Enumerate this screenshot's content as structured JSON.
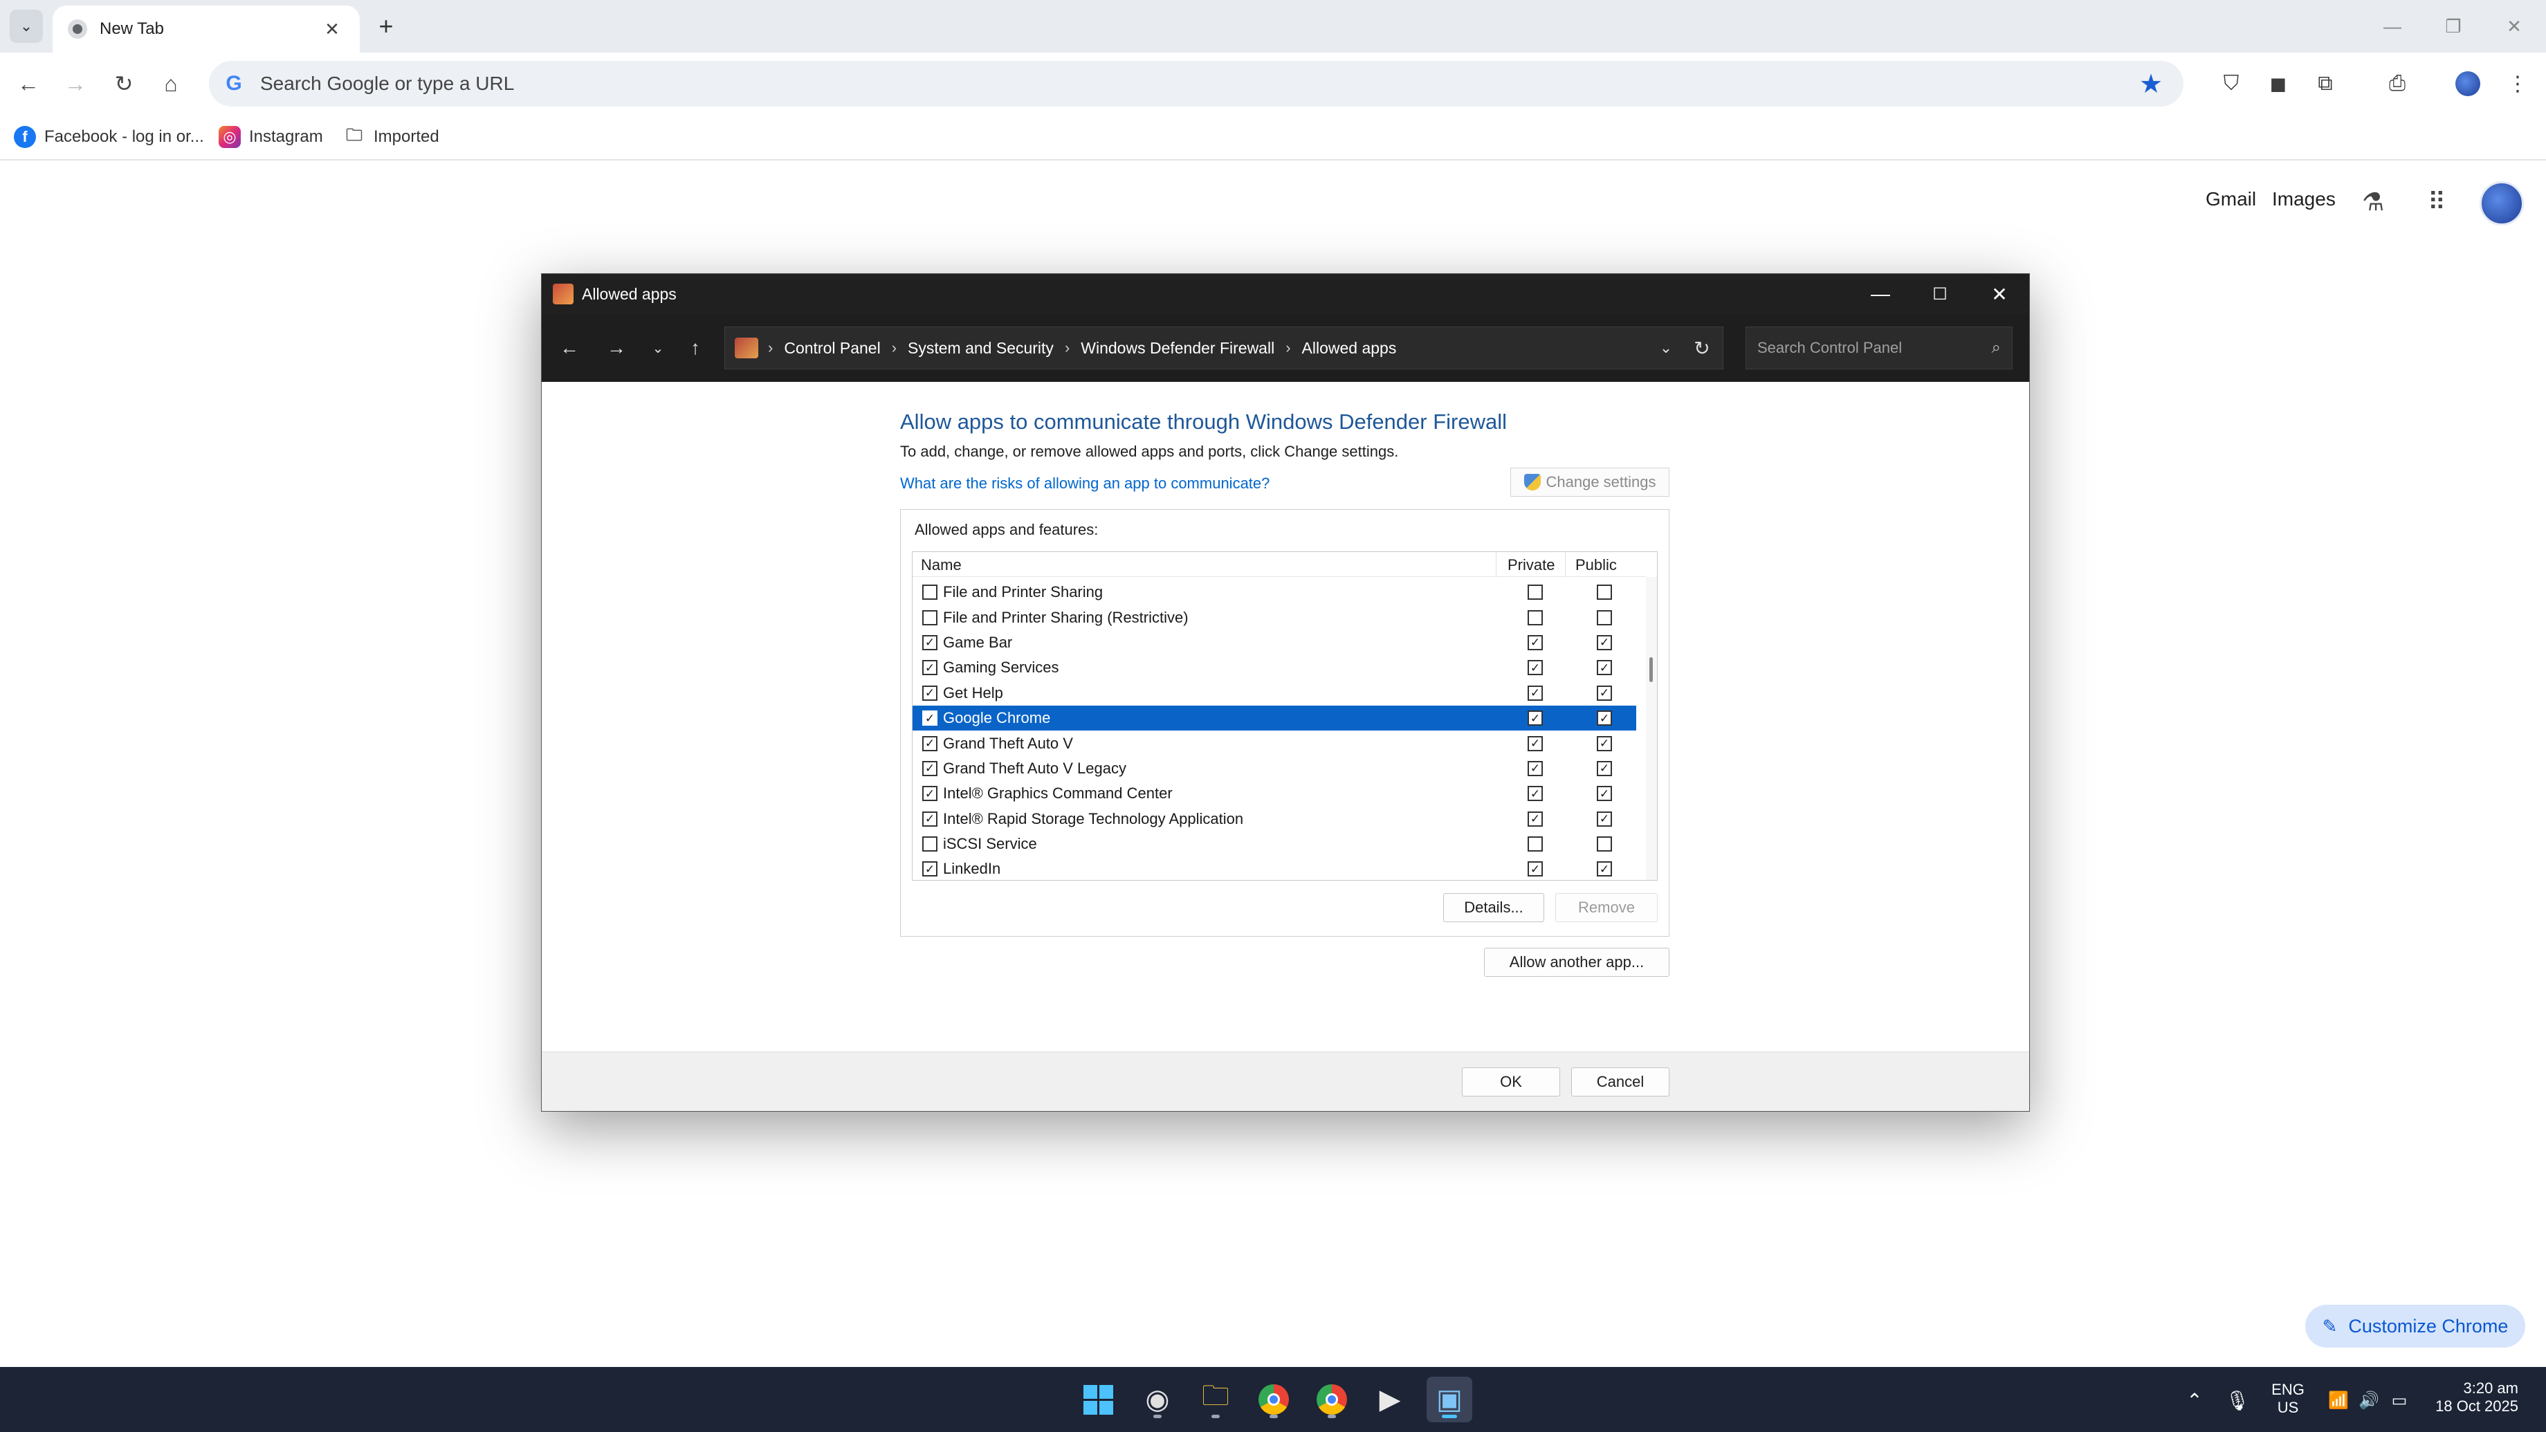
{
  "browser": {
    "tab_title": "New Tab",
    "omnibox_placeholder": "Search Google or type a URL",
    "bookmarks": [
      "Facebook - log in or...",
      "Instagram",
      "Imported"
    ],
    "ntp_links": [
      "Gmail",
      "Images"
    ],
    "customize_label": "Customize Chrome"
  },
  "dialog": {
    "title": "Allowed apps",
    "breadcrumb": [
      "Control Panel",
      "System and Security",
      "Windows Defender Firewall",
      "Allowed apps"
    ],
    "search_placeholder": "Search Control Panel",
    "heading": "Allow apps to communicate through Windows Defender Firewall",
    "subtext": "To add, change, or remove allowed apps and ports, click Change settings.",
    "risk_link": "What are the risks of allowing an app to communicate?",
    "change_settings": "Change settings",
    "group_label": "Allowed apps and features:",
    "columns": {
      "name": "Name",
      "private": "Private",
      "public": "Public"
    },
    "rows": [
      {
        "name": "File and Printer Sharing",
        "enabled": false,
        "private": false,
        "public": false
      },
      {
        "name": "File and Printer Sharing (Restrictive)",
        "enabled": false,
        "private": false,
        "public": false
      },
      {
        "name": "Game Bar",
        "enabled": true,
        "private": true,
        "public": true
      },
      {
        "name": "Gaming Services",
        "enabled": true,
        "private": true,
        "public": true
      },
      {
        "name": "Get Help",
        "enabled": true,
        "private": true,
        "public": true
      },
      {
        "name": "Google Chrome",
        "enabled": true,
        "private": true,
        "public": true,
        "selected": true
      },
      {
        "name": "Grand Theft Auto V",
        "enabled": true,
        "private": true,
        "public": true
      },
      {
        "name": "Grand Theft Auto V Legacy",
        "enabled": true,
        "private": true,
        "public": true
      },
      {
        "name": "Intel® Graphics Command Center",
        "enabled": true,
        "private": true,
        "public": true
      },
      {
        "name": "Intel® Rapid Storage Technology Application",
        "enabled": true,
        "private": true,
        "public": true
      },
      {
        "name": "iSCSI Service",
        "enabled": false,
        "private": false,
        "public": false
      },
      {
        "name": "LinkedIn",
        "enabled": true,
        "private": true,
        "public": true
      }
    ],
    "details_button": "Details...",
    "remove_button": "Remove",
    "allow_another_button": "Allow another app...",
    "ok_button": "OK",
    "cancel_button": "Cancel"
  },
  "taskbar": {
    "lang_top": "ENG",
    "lang_bottom": "US",
    "time": "3:20 am",
    "date": "18 Oct 2025"
  },
  "colors": {
    "selection": "#0a64c8",
    "heading": "#1e5799",
    "link": "#0066cc",
    "taskbar": "#1c2436"
  }
}
